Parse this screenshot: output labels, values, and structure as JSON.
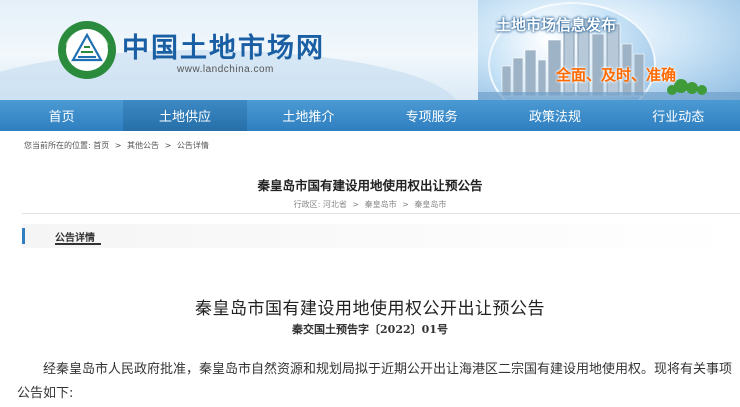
{
  "header": {
    "site_name": "中国土地市场网",
    "site_url": "www.landchina.com",
    "emblem_text": "WWW.LANDCHINA.COM",
    "emblem_top_text": "中国土地市场网",
    "banner_title": "土地市场信息发布",
    "banner_slogan": "全面、及时、准确"
  },
  "nav": {
    "items": [
      "首页",
      "土地供应",
      "土地推介",
      "专项服务",
      "政策法规",
      "行业动态"
    ],
    "active": "土地供应"
  },
  "breadcrumb": {
    "prefix": "您当前所在的位置:",
    "items": [
      "首页",
      "其他公告",
      "公告详情"
    ],
    "separator": ">"
  },
  "notice": {
    "title": "秦皇岛市国有建设用地使用权出让预公告",
    "region_label": "行政区:",
    "region_path": [
      "河北省",
      "秦皇岛市",
      "秦皇岛市"
    ],
    "separator": ">"
  },
  "section": {
    "label": "公告详情"
  },
  "document": {
    "title": "秦皇岛市国有建设用地使用权公开出让预公告",
    "number": "秦交国土预告字〔2022〕01号",
    "paragraph": "经秦皇岛市人民政府批准，秦皇岛市自然资源和规划局拟于近期公开出让海港区二宗国有建设用地使用权。现将有关事项公告如下:"
  },
  "colors": {
    "nav_bg": "#3a8acb",
    "brand_blue": "#1a5ea3",
    "slogan_orange": "#ff6a00"
  }
}
